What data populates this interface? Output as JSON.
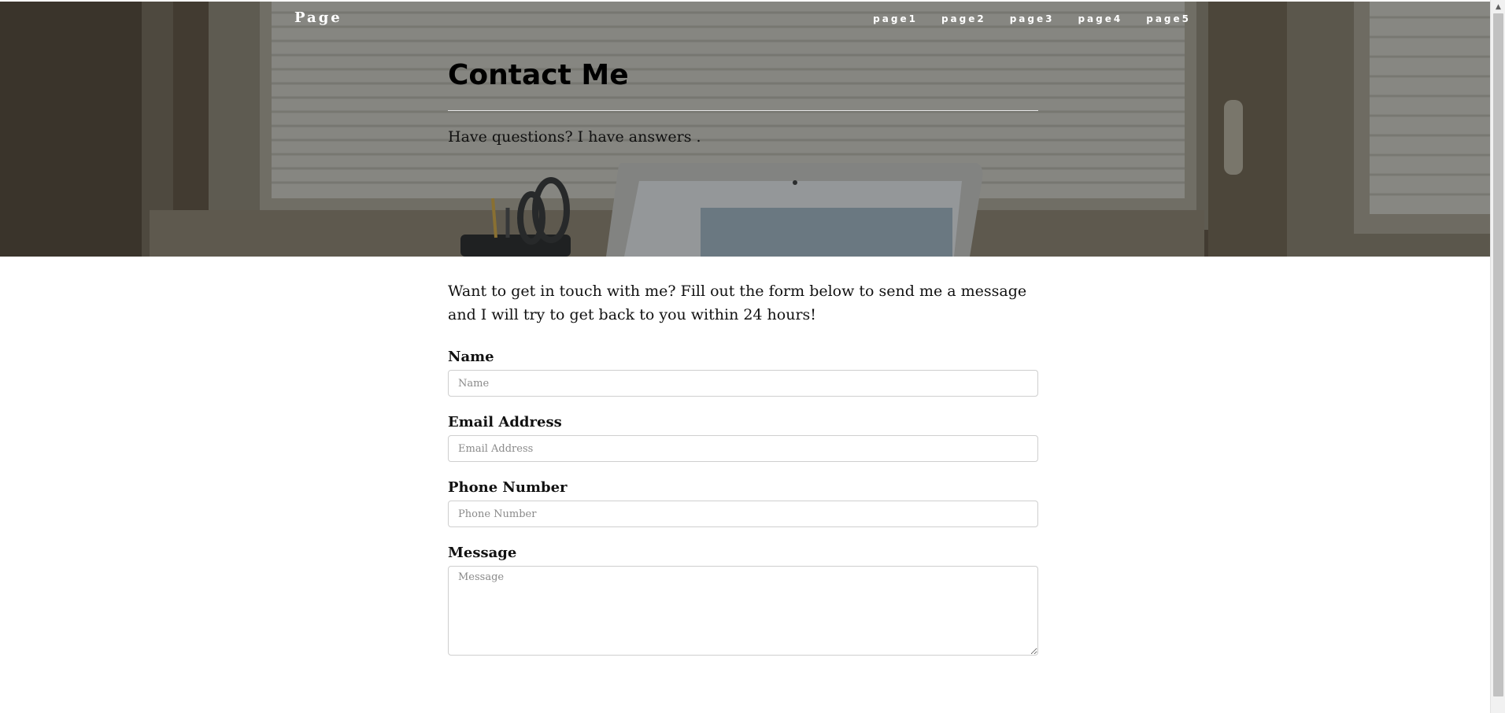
{
  "brand": "Page",
  "nav": {
    "items": [
      "page1",
      "page2",
      "page3",
      "page4",
      "page5"
    ]
  },
  "header": {
    "title": "Contact Me",
    "subheading": "Have questions? I have answers ."
  },
  "main": {
    "intro": "Want to get in touch with me? Fill out the form below to send me a message and I will try to get back to you within 24 hours!"
  },
  "form": {
    "name": {
      "label": "Name",
      "placeholder": "Name",
      "value": ""
    },
    "email": {
      "label": "Email Address",
      "placeholder": "Email Address",
      "value": ""
    },
    "phone": {
      "label": "Phone Number",
      "placeholder": "Phone Number",
      "value": ""
    },
    "message": {
      "label": "Message",
      "placeholder": "Message",
      "value": ""
    }
  },
  "scrollbar": {
    "up_icon": "scroll-up-arrow-icon"
  },
  "colors": {
    "hero_overlay": "#212529",
    "text": "#111111",
    "nav_text": "#ffffff",
    "input_border": "#cfcfcf"
  }
}
